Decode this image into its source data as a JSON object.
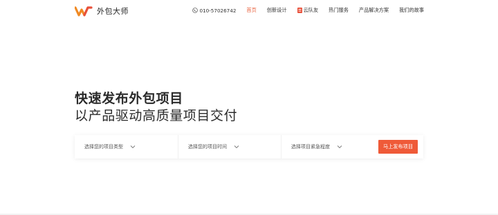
{
  "header": {
    "brand": "外包大师",
    "phone": "010-57026742",
    "nav": [
      {
        "label": "首页",
        "active": true
      },
      {
        "label": "创新设计",
        "active": false
      },
      {
        "label": "云队友",
        "active": false
      },
      {
        "label": "热门服务",
        "active": false
      },
      {
        "label": "产品解决方案",
        "active": false
      },
      {
        "label": "我们的故事",
        "active": false
      }
    ]
  },
  "hero": {
    "title": "快速发布外包项目",
    "subtitle": "以产品驱动高质量项目交付"
  },
  "search": {
    "type_placeholder": "选择您的项目类型",
    "time_placeholder": "选择您的项目时间",
    "urgency_placeholder": "选择项目紧急程度",
    "submit_label": "马上发布项目"
  },
  "colors": {
    "accent": "#ef5a38",
    "active_nav": "#e8603c",
    "logo_orange": "#f08a24",
    "logo_red": "#e8503a"
  },
  "icons": [
    "logo-mark",
    "phone-icon",
    "team-icon",
    "chevron-down-icon"
  ]
}
